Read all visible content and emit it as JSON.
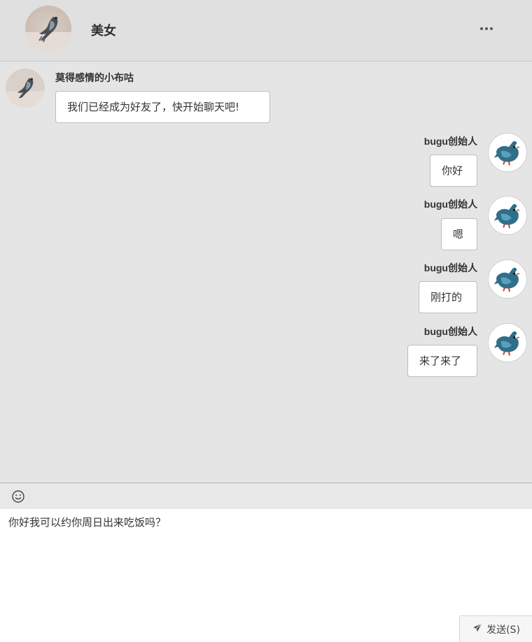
{
  "header": {
    "contact_name": "美女",
    "more_icon": "ellipsis-icon"
  },
  "messages": [
    {
      "side": "left",
      "sender": "莫得感情的小布咕",
      "text": "我们已经成为好友了，快开始聊天吧!"
    },
    {
      "side": "right",
      "sender": "bugu创始人",
      "text": "你好"
    },
    {
      "side": "right",
      "sender": "bugu创始人",
      "text": "嗯"
    },
    {
      "side": "right",
      "sender": "bugu创始人",
      "text": "刚打的"
    },
    {
      "side": "right",
      "sender": "bugu创始人",
      "text": "来了来了"
    }
  ],
  "toolbar": {
    "emoji_icon": "smiley-icon"
  },
  "composer": {
    "value": "你好我可以约你周日出来吃饭吗？",
    "send_label": "发送(S)",
    "send_icon": "paper-plane-icon"
  },
  "colors": {
    "background": "#e5e5e5",
    "header": "#e0e0e0",
    "bubble": "#ffffff",
    "bubble_border": "#bdbdbd"
  }
}
